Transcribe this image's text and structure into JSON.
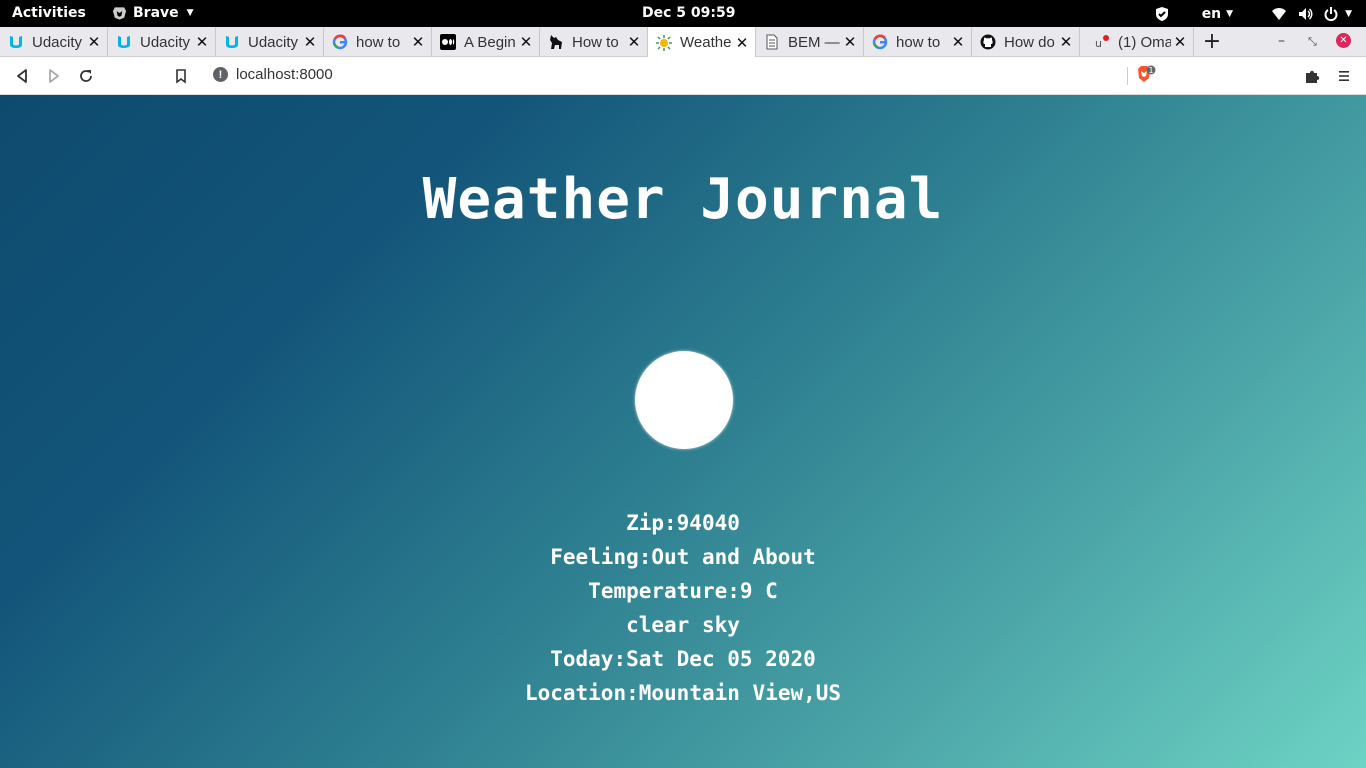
{
  "topbar": {
    "activities": "Activities",
    "app_name": "Brave",
    "clock": "Dec 5  09:59",
    "language": "en"
  },
  "tabs": [
    {
      "title": "Udacity",
      "icon": "udacity-icon"
    },
    {
      "title": "Udacity",
      "icon": "udacity-icon"
    },
    {
      "title": "Udacity",
      "icon": "udacity-icon"
    },
    {
      "title": "how to",
      "icon": "google-icon"
    },
    {
      "title": "A Begin",
      "icon": "medium-icon"
    },
    {
      "title": "How to",
      "icon": "dog-icon"
    },
    {
      "title": "Weathe",
      "icon": "weather-icon",
      "active": true
    },
    {
      "title": "BEM —",
      "icon": "document-icon"
    },
    {
      "title": "how to",
      "icon": "google-icon"
    },
    {
      "title": "How do",
      "icon": "github-icon"
    },
    {
      "title": "(1) Oma",
      "icon": "notification-icon"
    }
  ],
  "toolbar": {
    "url": "localhost:8000",
    "shield_badge": "1"
  },
  "page": {
    "title": "Weather Journal",
    "entries": {
      "zip": "Zip:94040",
      "feeling": "Feeling:Out and About",
      "temperature": "Temperature:9 C",
      "description": "clear sky",
      "date": "Today:Sat Dec 05 2020",
      "location": "Location:Mountain View,US"
    }
  },
  "colors": {
    "gradient_start": "#0e4a6e",
    "gradient_end": "#6dd3c4",
    "close_button": "#e0245e"
  }
}
